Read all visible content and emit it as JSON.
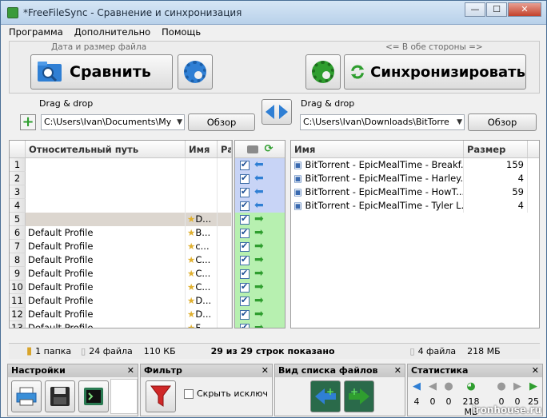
{
  "window": {
    "title": "*FreeFileSync - Сравнение и синхронизация",
    "minimize": "—",
    "maximize": "☐",
    "close": "✕"
  },
  "menu": [
    "Программа",
    "Дополнительно",
    "Помощь"
  ],
  "toolbar": {
    "compare_caption": "Дата и размер файла",
    "compare_label": "Сравнить",
    "sync_caption": "<= В обе стороны =>",
    "sync_label": "Синхронизировать"
  },
  "folders": {
    "left_caption": "Drag & drop",
    "left_path": "C:\\Users\\Ivan\\Documents\\My",
    "right_caption": "Drag & drop",
    "right_path": "C:\\Users\\Ivan\\Downloads\\BitTorre",
    "browse_label": "Обзор"
  },
  "left_grid": {
    "columns": [
      "Относительный путь",
      "Имя",
      "Ра"
    ],
    "rows": [
      {
        "num": "1",
        "path": "",
        "name": ""
      },
      {
        "num": "2",
        "path": "",
        "name": ""
      },
      {
        "num": "3",
        "path": "",
        "name": ""
      },
      {
        "num": "4",
        "path": "",
        "name": ""
      },
      {
        "num": "5",
        "path": "",
        "name": "D..."
      },
      {
        "num": "6",
        "path": "Default Profile",
        "name": "B..."
      },
      {
        "num": "7",
        "path": "Default Profile",
        "name": "c..."
      },
      {
        "num": "8",
        "path": "Default Profile",
        "name": "C..."
      },
      {
        "num": "9",
        "path": "Default Profile",
        "name": "C..."
      },
      {
        "num": "10",
        "path": "Default Profile",
        "name": "C..."
      },
      {
        "num": "11",
        "path": "Default Profile",
        "name": "D..."
      },
      {
        "num": "12",
        "path": "Default Profile",
        "name": "D..."
      },
      {
        "num": "13",
        "path": "Default Profile",
        "name": "F..."
      }
    ]
  },
  "right_grid": {
    "columns": [
      "Имя",
      "Размер"
    ],
    "rows": [
      {
        "name": "BitTorrent - EpicMealTime - Breakf...",
        "size": "159"
      },
      {
        "name": "BitTorrent - EpicMealTime - Harley...",
        "size": "4"
      },
      {
        "name": "BitTorrent - EpicMealTime - HowT...",
        "size": "59"
      },
      {
        "name": "BitTorrent - EpicMealTime - Tyler L...",
        "size": "4"
      }
    ]
  },
  "status": {
    "left_folders": "1 папка",
    "left_files": "24 файла",
    "left_size": "110 КБ",
    "center": "29 из 29 строк показано",
    "right_files": "4 файла",
    "right_size": "218 МБ"
  },
  "panels": {
    "settings_title": "Настройки",
    "filter_title": "Фильтр",
    "hide_label": "Скрыть исключ",
    "view_title": "Вид списка файлов",
    "stats_title": "Статистика",
    "close_glyph": "✕",
    "stats": [
      "4",
      "0",
      "0",
      "218 МБ",
      "0",
      "0",
      "25"
    ]
  },
  "colors": {
    "sync_green": "#2f9e2f",
    "blue_accent": "#2f7fd4",
    "mid_blue": "#c8d4f6",
    "mid_green": "#b7f0b0"
  },
  "watermark": "ironhouse.ru"
}
